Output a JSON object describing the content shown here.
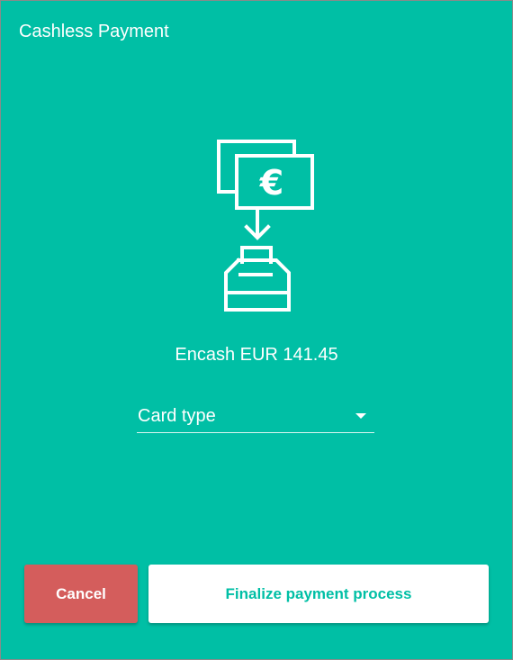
{
  "dialog": {
    "title": "Cashless Payment",
    "icon": "cash-to-register-icon",
    "currency_symbol": "€",
    "amount_text": "Encash EUR 141.45",
    "card_type": {
      "label": "Card type"
    },
    "buttons": {
      "cancel": "Cancel",
      "finalize": "Finalize payment process"
    }
  },
  "colors": {
    "background": "#00bfa5",
    "cancel_button": "#d45d5c",
    "finalize_button": "#ffffff",
    "finalize_text": "#00bfa5",
    "text": "#ffffff"
  }
}
